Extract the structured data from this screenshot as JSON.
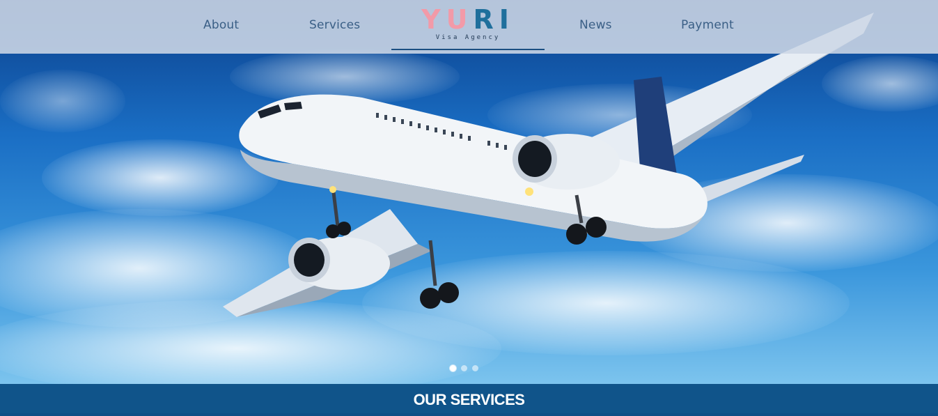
{
  "nav": {
    "about": "About",
    "services": "Services",
    "news": "News",
    "payment": "Payment"
  },
  "logo": {
    "word_part1": "YU",
    "word_part2": "RI",
    "tagline": "Visa Agency"
  },
  "carousel": {
    "slide_count": 3,
    "active_index": 0
  },
  "section": {
    "title": "OUR SERVICES"
  },
  "colors": {
    "header_bg": "#cdd7e6",
    "nav_text": "#3a5f86",
    "logo_pink": "#f29aa8",
    "logo_blue": "#1f6f9c",
    "services_bar": "#10548a"
  }
}
